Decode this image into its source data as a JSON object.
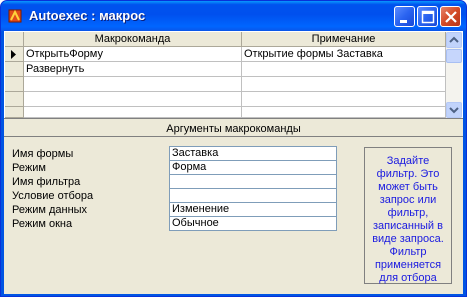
{
  "window": {
    "title": "Autoexec : макрос"
  },
  "grid": {
    "columns": [
      "Макрокоманда",
      "Примечание"
    ],
    "rows": [
      {
        "action": "ОткрытьФорму",
        "note": "Открытие формы Заставка",
        "current": true
      },
      {
        "action": "Развернуть",
        "note": "",
        "current": false
      },
      {
        "action": "",
        "note": "",
        "current": false
      },
      {
        "action": "",
        "note": "",
        "current": false
      },
      {
        "action": "",
        "note": "",
        "current": false
      }
    ]
  },
  "arguments": {
    "title": "Аргументы макрокоманды",
    "fields": [
      {
        "label": "Имя формы",
        "value": "Заставка"
      },
      {
        "label": "Режим",
        "value": "Форма"
      },
      {
        "label": "Имя фильтра",
        "value": ""
      },
      {
        "label": "Условие отбора",
        "value": ""
      },
      {
        "label": "Режим данных",
        "value": "Изменение"
      },
      {
        "label": "Режим окна",
        "value": "Обычное"
      }
    ],
    "help": "Задайте фильтр. Это может быть запрос или фильтр, записанный в виде запроса. Фильтр применяется для отбора"
  },
  "colors": {
    "titlebar": "#0054e3",
    "help_text": "#1a1ae0"
  }
}
